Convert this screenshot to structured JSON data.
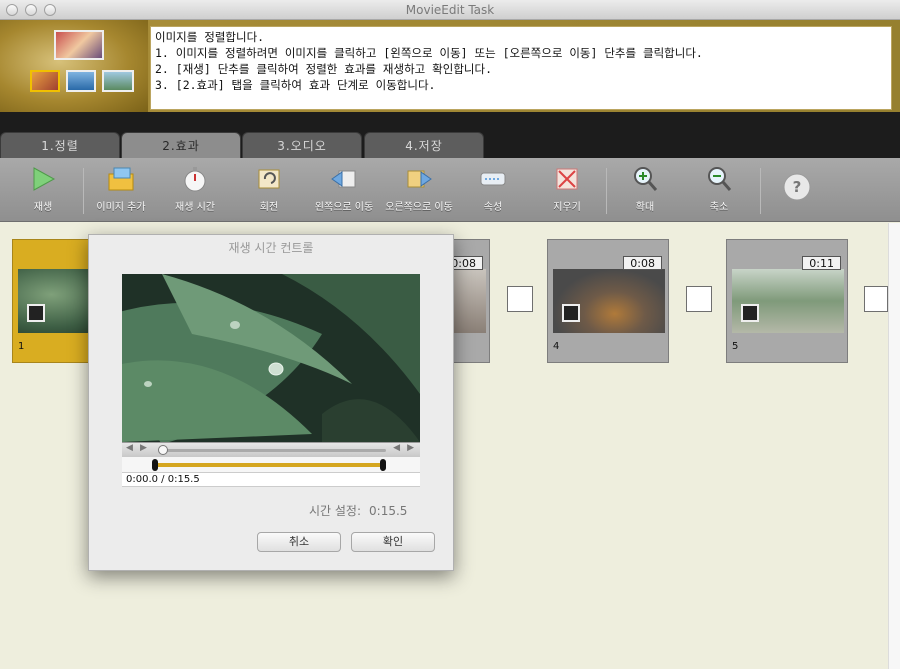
{
  "window": {
    "title": "MovieEdit Task"
  },
  "instructions": [
    "이미지를 정렬합니다.",
    "1. 이미지를 정렬하려면 이미지를 클릭하고 [왼쪽으로 이동] 또는 [오른쪽으로 이동] 단추를 클릭합니다.",
    "2. [재생] 단추를 클릭하여 정렬한 효과를 재생하고 확인합니다.",
    "3. [2.효과] 탭을 클릭하여 효과 단계로 이동합니다."
  ],
  "tabs": [
    {
      "label": "1.정렬"
    },
    {
      "label": "2.효과",
      "active": true
    },
    {
      "label": "3.오디오"
    },
    {
      "label": "4.저장"
    }
  ],
  "toolbar": [
    {
      "label": "재생",
      "icon": "play-icon"
    },
    {
      "label": "이미지 추가",
      "icon": "add-image-folder-icon"
    },
    {
      "label": "재생 시간",
      "icon": "stopwatch-icon"
    },
    {
      "label": "회전",
      "icon": "rotate-icon"
    },
    {
      "label": "왼쪽으로 이동",
      "icon": "move-left-icon"
    },
    {
      "label": "오른쪽으로 이동",
      "icon": "move-right-icon"
    },
    {
      "label": "속성",
      "icon": "properties-icon"
    },
    {
      "label": "지우기",
      "icon": "delete-icon"
    },
    {
      "label": "확대",
      "icon": "zoom-in-icon"
    },
    {
      "label": "축소",
      "icon": "zoom-out-icon"
    },
    {
      "label": "",
      "icon": "help-icon"
    }
  ],
  "timeline": [
    {
      "number": "1",
      "duration": "",
      "selected": true
    },
    {
      "number": "",
      "duration": "0:08",
      "selected": false
    },
    {
      "number": "4",
      "duration": "0:08",
      "selected": false
    },
    {
      "number": "5",
      "duration": "0:11",
      "selected": false
    }
  ],
  "dialog": {
    "title": "재생 시간 컨트롤",
    "timecode": "0:00.0 / 0:15.5",
    "time_setting_label": "시간 설정:",
    "time_setting_value": "0:15.5",
    "cancel_label": "취소",
    "ok_label": "확인"
  },
  "colors": {
    "selected_thumb": "#d9ad21",
    "trim_bar": "#d5a61f"
  }
}
